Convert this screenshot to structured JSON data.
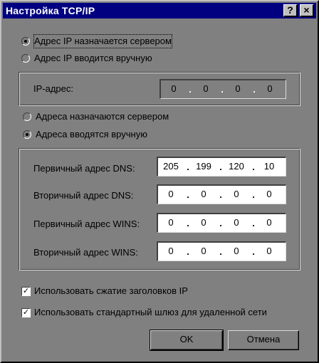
{
  "window": {
    "title": "Настройка TCP/IP",
    "help_glyph": "?",
    "close_glyph": "×"
  },
  "ip_mode": {
    "server_label": "Адрес IP назначается сервером",
    "manual_label": "Адрес IP вводится вручную",
    "selected": "server"
  },
  "ip_address": {
    "label": "IP-адрес:",
    "octets": [
      "0",
      "0",
      "0",
      "0"
    ],
    "disabled": true
  },
  "dns_mode": {
    "server_label": "Адреса назначаются сервером",
    "manual_label": "Адреса вводятся вручную",
    "selected": "manual"
  },
  "addresses": [
    {
      "label": "Первичный адрес DNS:",
      "octets": [
        "205",
        "199",
        "120",
        "10"
      ]
    },
    {
      "label": "Вторичный адрес DNS:",
      "octets": [
        "0",
        "0",
        "0",
        "0"
      ]
    },
    {
      "label": "Первичный адрес WINS:",
      "octets": [
        "0",
        "0",
        "0",
        "0"
      ]
    },
    {
      "label": "Вторичный адрес WINS:",
      "octets": [
        "0",
        "0",
        "0",
        "0"
      ]
    }
  ],
  "options": {
    "header_compression": {
      "label": "Использовать сжатие заголовков IP",
      "checked": true
    },
    "default_gateway": {
      "label": "Использовать стандартный шлюз для удаленной сети",
      "checked": true
    },
    "check_glyph": "✓"
  },
  "buttons": {
    "ok_label": "OK",
    "cancel_label": "Отмена"
  },
  "colors": {
    "titlebar": "#000080",
    "face": "#808080"
  }
}
